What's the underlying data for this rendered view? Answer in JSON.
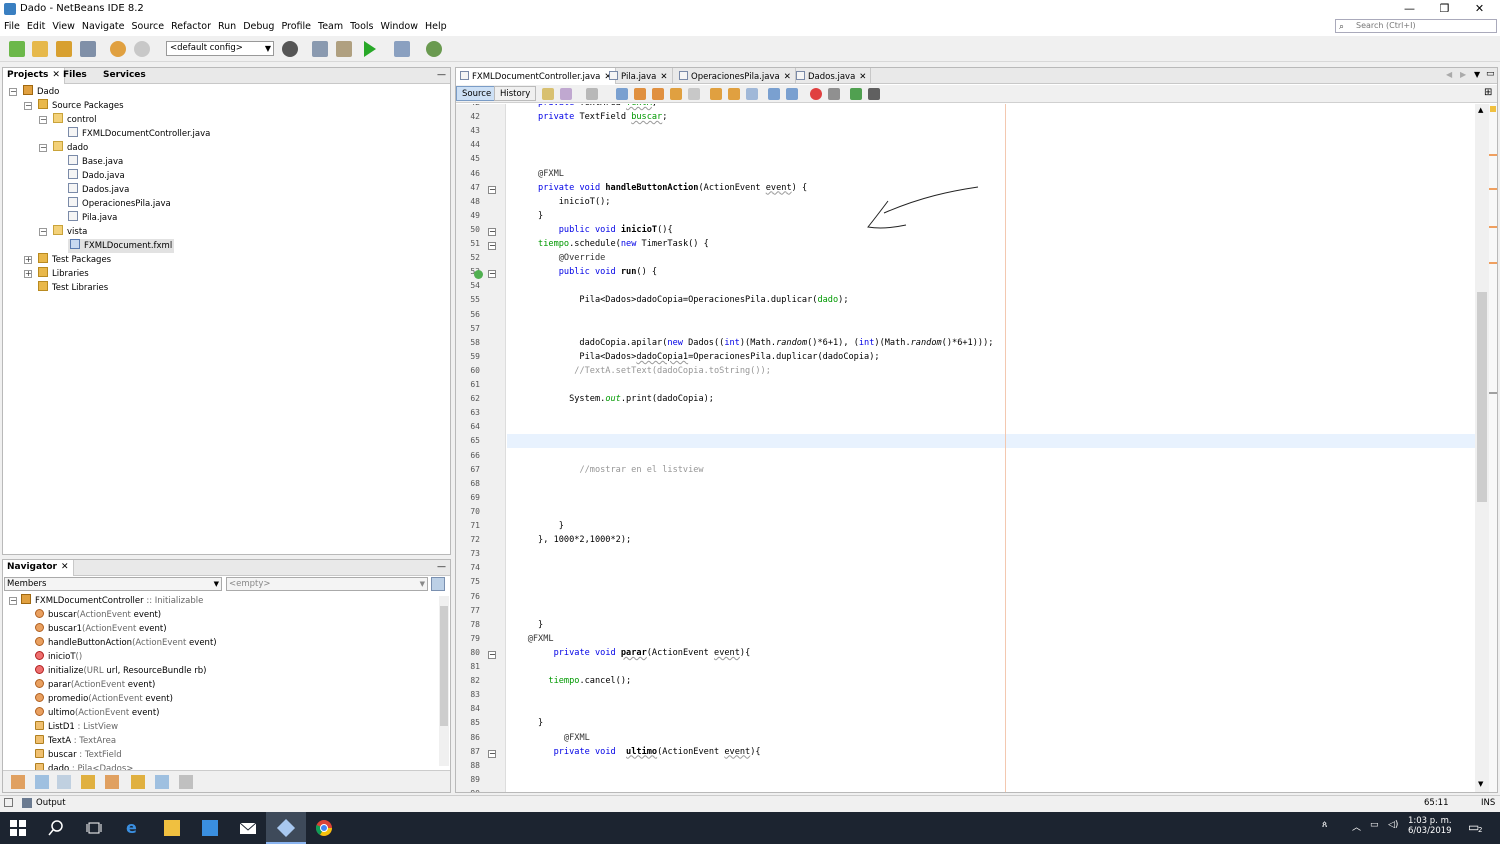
{
  "window": {
    "title": "Dado - NetBeans IDE 8.2",
    "minimize": "—",
    "restore": "❐",
    "close": "✕"
  },
  "menu": [
    "File",
    "Edit",
    "View",
    "Navigate",
    "Source",
    "Refactor",
    "Run",
    "Debug",
    "Profile",
    "Team",
    "Tools",
    "Window",
    "Help"
  ],
  "search": {
    "placeholder": "Search (Ctrl+I)"
  },
  "toolbar": {
    "config": "<default config>"
  },
  "projects": {
    "tabs": [
      "Projects",
      "Files",
      "Services"
    ],
    "tree": [
      {
        "label": "Dado",
        "depth": 0,
        "icon": "proj",
        "exp": "−"
      },
      {
        "label": "Source Packages",
        "depth": 1,
        "icon": "folder",
        "exp": "−"
      },
      {
        "label": "control",
        "depth": 2,
        "icon": "pkg",
        "exp": "−"
      },
      {
        "label": "FXMLDocumentController.java",
        "depth": 3,
        "icon": "jfile",
        "exp": ""
      },
      {
        "label": "dado",
        "depth": 2,
        "icon": "pkg",
        "exp": "−"
      },
      {
        "label": "Base.java",
        "depth": 3,
        "icon": "jfile",
        "exp": ""
      },
      {
        "label": "Dado.java",
        "depth": 3,
        "icon": "jfile",
        "exp": ""
      },
      {
        "label": "Dados.java",
        "depth": 3,
        "icon": "jfile",
        "exp": ""
      },
      {
        "label": "OperacionesPila.java",
        "depth": 3,
        "icon": "jfile",
        "exp": ""
      },
      {
        "label": "Pila.java",
        "depth": 3,
        "icon": "jfile",
        "exp": ""
      },
      {
        "label": "vista",
        "depth": 2,
        "icon": "pkg",
        "exp": "−"
      },
      {
        "label": "FXMLDocument.fxml",
        "depth": 3,
        "icon": "fxml",
        "exp": "",
        "selected": true
      },
      {
        "label": "Test Packages",
        "depth": 1,
        "icon": "folder",
        "exp": "+"
      },
      {
        "label": "Libraries",
        "depth": 1,
        "icon": "folder",
        "exp": "+"
      },
      {
        "label": "Test Libraries",
        "depth": 1,
        "icon": "folder",
        "exp": ""
      }
    ]
  },
  "navigator": {
    "tab": "Navigator",
    "members_combo": "Members",
    "empty_combo": "<empty>",
    "root": "FXMLDocumentController",
    "root_sub": " :: Initializable",
    "items": [
      {
        "name": "buscar",
        "sig": "(ActionEvent",
        "sig2": " event)",
        "kind": "pub"
      },
      {
        "name": "buscar1",
        "sig": "(ActionEvent",
        "sig2": " event)",
        "kind": "pub"
      },
      {
        "name": "handleButtonAction",
        "sig": "(ActionEvent",
        "sig2": " event)",
        "kind": "pub"
      },
      {
        "name": "inicioT",
        "sig": "()",
        "sig2": "",
        "kind": "priv"
      },
      {
        "name": "initialize",
        "sig": "(URL",
        "sig2": " url, ResourceBundle rb)",
        "kind": "priv"
      },
      {
        "name": "parar",
        "sig": "(ActionEvent",
        "sig2": " event)",
        "kind": "pub"
      },
      {
        "name": "promedio",
        "sig": "(ActionEvent",
        "sig2": " event)",
        "kind": "pub"
      },
      {
        "name": "ultimo",
        "sig": "(ActionEvent",
        "sig2": " event)",
        "kind": "pub"
      },
      {
        "name": "ListD1",
        "sig": " : ListView",
        "sig2": "",
        "kind": "field"
      },
      {
        "name": "TextA",
        "sig": " : TextArea",
        "sig2": "",
        "kind": "field"
      },
      {
        "name": "buscar",
        "sig": " : TextField",
        "sig2": "",
        "kind": "field"
      },
      {
        "name": "dado",
        "sig": " : Pila<Dados>",
        "sig2": "",
        "kind": "field"
      }
    ]
  },
  "editor": {
    "tabs": [
      "FXMLDocumentController.java",
      "Pila.java",
      "OperacionesPila.java",
      "Dados.java"
    ],
    "source_btn": "Source",
    "history_btn": "History",
    "lines": [
      {
        "n": "42",
        "html": "      <span class='kw'>private</span> TextArea <span class='fld ul'>TextA</span>;"
      },
      {
        "n": "42",
        "html": "      <span class='kw'>private</span> TextField <span class='fld ul'>buscar</span>;"
      },
      {
        "n": "43",
        "html": ""
      },
      {
        "n": "44",
        "html": ""
      },
      {
        "n": "45",
        "html": ""
      },
      {
        "n": "46",
        "html": "      <span class='ann'>@FXML</span>"
      },
      {
        "n": "47",
        "html": "      <span class='kw'>private</span> <span class='kw'>void</span> <span class='bold'>handleButtonAction</span>(ActionEvent <span class='ul'>event</span>) {"
      },
      {
        "n": "48",
        "html": "          inicioT();"
      },
      {
        "n": "49",
        "html": "      }"
      },
      {
        "n": "50",
        "html": "          <span class='kw'>public</span> <span class='kw'>void</span> <span class='bold'>inicioT</span>(){"
      },
      {
        "n": "51",
        "html": "      <span class='fld'>tiempo</span>.schedule(<span class='kw'>new</span> TimerTask() {"
      },
      {
        "n": "52",
        "html": "          <span class='ann'>@Override</span>"
      },
      {
        "n": "53",
        "html": "          <span class='kw'>public</span> <span class='kw'>void</span> <span class='bold'>run</span>() {"
      },
      {
        "n": "54",
        "html": ""
      },
      {
        "n": "55",
        "html": "              Pila&lt;Dados&gt;dadoCopia=OperacionesPila.duplicar(<span class='fld'>dado</span>);"
      },
      {
        "n": "56",
        "html": ""
      },
      {
        "n": "57",
        "html": ""
      },
      {
        "n": "58",
        "html": "              dadoCopia.apilar(<span class='kw'>new</span> Dados((<span class='kw'>int</span>)(Math.<i>random</i>()*6+1), (<span class='kw'>int</span>)(Math.<i>random</i>()*6+1)));"
      },
      {
        "n": "59",
        "html": "              Pila&lt;Dados&gt;<span class='ul'>dadoCopia1</span>=OperacionesPila.duplicar(dadoCopia);"
      },
      {
        "n": "60",
        "html": "             <span class='cm'>//TextA.setText(dadoCopia.toString());</span>"
      },
      {
        "n": "61",
        "html": ""
      },
      {
        "n": "62",
        "html": "            System.<span class='fld'><i>out</i></span>.print(dadoCopia);"
      },
      {
        "n": "63",
        "html": ""
      },
      {
        "n": "64",
        "html": ""
      },
      {
        "n": "65",
        "html": ""
      },
      {
        "n": "66",
        "html": ""
      },
      {
        "n": "67",
        "html": "              <span class='cm'>//mostrar en el listview</span>"
      },
      {
        "n": "68",
        "html": ""
      },
      {
        "n": "69",
        "html": ""
      },
      {
        "n": "70",
        "html": ""
      },
      {
        "n": "71",
        "html": "          }"
      },
      {
        "n": "72",
        "html": "      }, 1000*2,1000*2);"
      },
      {
        "n": "73",
        "html": ""
      },
      {
        "n": "74",
        "html": ""
      },
      {
        "n": "75",
        "html": ""
      },
      {
        "n": "76",
        "html": ""
      },
      {
        "n": "77",
        "html": ""
      },
      {
        "n": "78",
        "html": "      }"
      },
      {
        "n": "79",
        "html": "    <span class='ann'>@FXML</span>"
      },
      {
        "n": "80",
        "html": "         <span class='kw'>private</span> <span class='kw'>void</span> <span class='bold ul'>parar</span>(ActionEvent <span class='ul'>event</span>){"
      },
      {
        "n": "81",
        "html": ""
      },
      {
        "n": "82",
        "html": "        <span class='fld'>tiempo</span>.cancel();"
      },
      {
        "n": "83",
        "html": ""
      },
      {
        "n": "84",
        "html": ""
      },
      {
        "n": "85",
        "html": "      }"
      },
      {
        "n": "86",
        "html": "           <span class='ann'>@FXML</span>"
      },
      {
        "n": "87",
        "html": "         <span class='kw'>private</span> <span class='kw'>void</span>  <span class='bold ul'>ultimo</span>(ActionEvent <span class='ul'>event</span>){"
      },
      {
        "n": "88",
        "html": ""
      },
      {
        "n": "89",
        "html": ""
      },
      {
        "n": "90",
        "html": ""
      }
    ]
  },
  "status": {
    "output": "Output",
    "position": "65:11",
    "mode": "INS"
  },
  "taskbar": {
    "time": "1:03 p. m.",
    "date": "6/03/2019",
    "notifications": "2"
  },
  "colors": {
    "keyword": "#0000e6",
    "field": "#009900",
    "comment": "#969696"
  }
}
